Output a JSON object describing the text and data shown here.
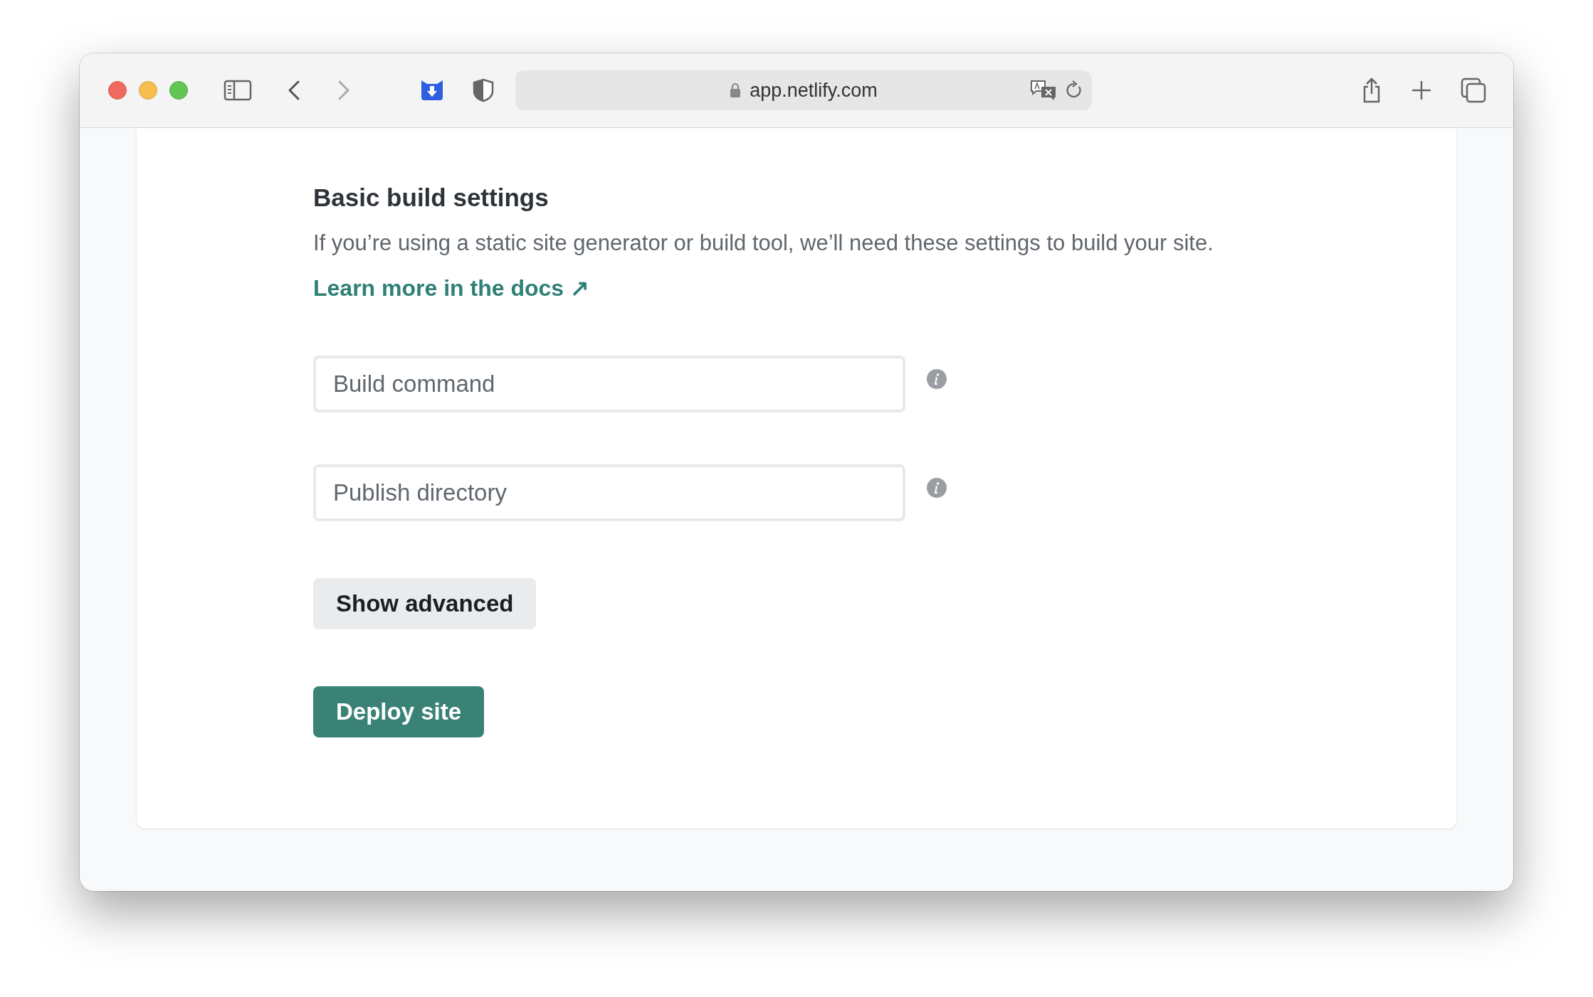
{
  "browser": {
    "url": "app.netlify.com"
  },
  "settings": {
    "title": "Basic build settings",
    "description": "If you’re using a static site generator or build tool, we’ll need these settings to build your site.",
    "link": "Learn more in the docs ↗",
    "fields": [
      {
        "placeholder": "Build command"
      },
      {
        "placeholder": "Publish directory"
      }
    ],
    "buttons": [
      {
        "label": "Show advanced",
        "kind": "secondary"
      },
      {
        "label": "Deploy site",
        "kind": "primary"
      }
    ]
  }
}
